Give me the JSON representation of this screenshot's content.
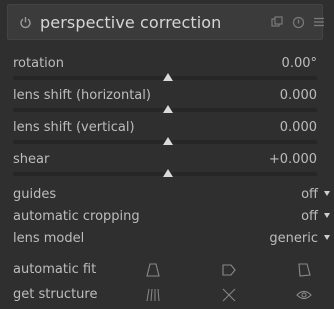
{
  "module": {
    "title": "perspective correction",
    "icons": [
      "power-icon",
      "presets-icon",
      "reset-icon",
      "menu-icon"
    ]
  },
  "sliders": [
    {
      "label": "rotation",
      "value": "0.00°",
      "thumb_fraction": 0.5
    },
    {
      "label": "lens shift (horizontal)",
      "value": "0.000",
      "thumb_fraction": 0.5
    },
    {
      "label": "lens shift (vertical)",
      "value": "0.000",
      "thumb_fraction": 0.5
    },
    {
      "label": "shear",
      "value": "+0.000",
      "thumb_fraction": 0.5
    }
  ],
  "combos": [
    {
      "label": "guides",
      "value": "off"
    },
    {
      "label": "automatic cropping",
      "value": "off"
    },
    {
      "label": "lens model",
      "value": "generic"
    }
  ],
  "buttons": {
    "automatic_fit": {
      "label": "automatic fit",
      "icons": [
        "vertical-fit-icon",
        "horizontal-fit-icon",
        "full-fit-icon"
      ]
    },
    "get_structure": {
      "label": "get structure",
      "icons": [
        "lines-icon",
        "clear-icon",
        "eye-icon"
      ]
    }
  },
  "colors": {
    "panel": "#2f2f2f",
    "header": "#3b3b3b",
    "text": "#bdbdbd",
    "thumb": "#d9d9d9"
  }
}
